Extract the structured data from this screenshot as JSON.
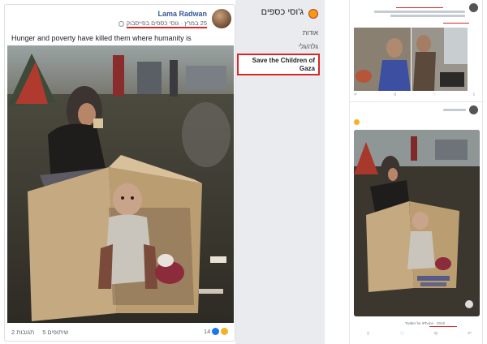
{
  "facebook_post": {
    "author": "Lama Radwan",
    "date_text": "25 במרץ · גוסי כספים בפייסבוק",
    "text": "Hunger and poverty have killed them where humanity is",
    "reactions_count": "14",
    "comments_text": "2 תגובות",
    "shares_text": "5 שיתופים"
  },
  "page_sidebar": {
    "title": "ג'וסי כספים",
    "items": [
      "אודות",
      "גלה/גלי"
    ],
    "highlighted_item": "Save the Children of Gaza"
  },
  "twitter": {
    "actions": [
      "↺",
      "♡"
    ],
    "share_icon": "share-icon",
    "via_text": "Twitter for iPhone · 2018 ..."
  },
  "colors": {
    "highlight_red": "#d62828",
    "fb_blue": "#385898",
    "sidebar_bg": "#e9ebee"
  },
  "icons": [
    "globe-icon",
    "like-icon",
    "sad-icon",
    "page-logo-icon",
    "reply-icon",
    "retweet-icon",
    "heart-icon",
    "share-icon"
  ]
}
